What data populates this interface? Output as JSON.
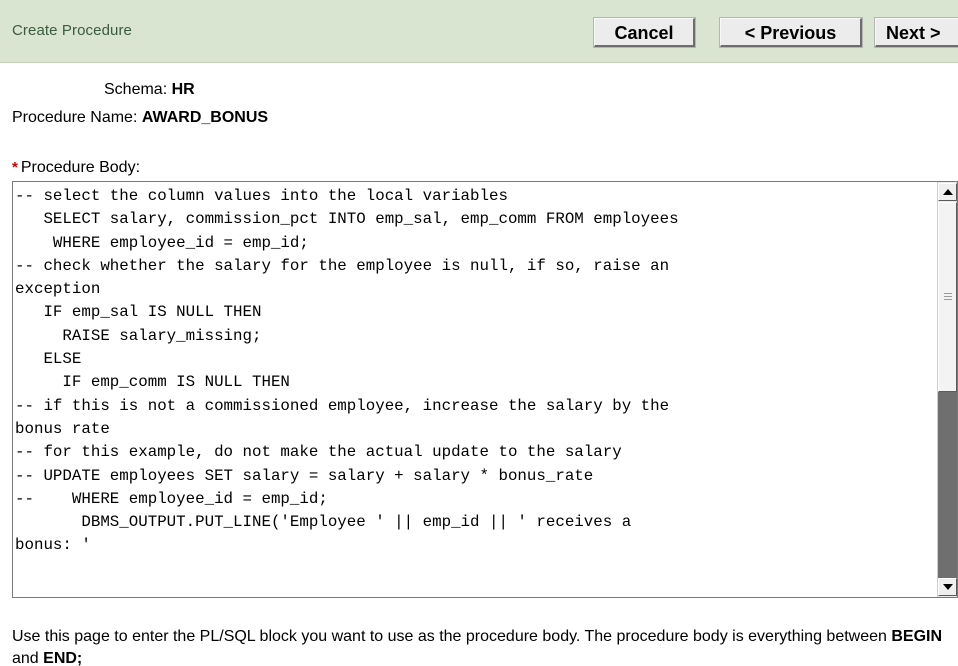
{
  "header": {
    "title": "Create Procedure",
    "buttons": {
      "cancel": "Cancel",
      "previous": "< Previous",
      "next": "Next >"
    }
  },
  "form": {
    "schema_label": "Schema:",
    "schema_value": "HR",
    "procedure_name_label": "Procedure Name:",
    "procedure_name_value": "AWARD_BONUS",
    "required_marker": "*",
    "procedure_body_label": "Procedure Body:",
    "procedure_body": "-- select the column values into the local variables\n   SELECT salary, commission_pct INTO emp_sal, emp_comm FROM employees\n    WHERE employee_id = emp_id;\n-- check whether the salary for the employee is null, if so, raise an\nexception\n   IF emp_sal IS NULL THEN\n     RAISE salary_missing;\n   ELSE\n     IF emp_comm IS NULL THEN\n-- if this is not a commissioned employee, increase the salary by the\nbonus rate\n-- for this example, do not make the actual update to the salary\n-- UPDATE employees SET salary = salary + salary * bonus_rate\n--    WHERE employee_id = emp_id;\n       DBMS_OUTPUT.PUT_LINE('Employee ' || emp_id || ' receives a\nbonus: '"
  },
  "help": {
    "text_part1": "Use this page to enter the PL/SQL block you want to use as the procedure body. The procedure body is everything between ",
    "begin": "BEGIN",
    "and": " and ",
    "end": "END;"
  },
  "colors": {
    "header_bg": "#d9e4d1",
    "header_title": "#3b5b3e",
    "required": "#cc0000"
  }
}
